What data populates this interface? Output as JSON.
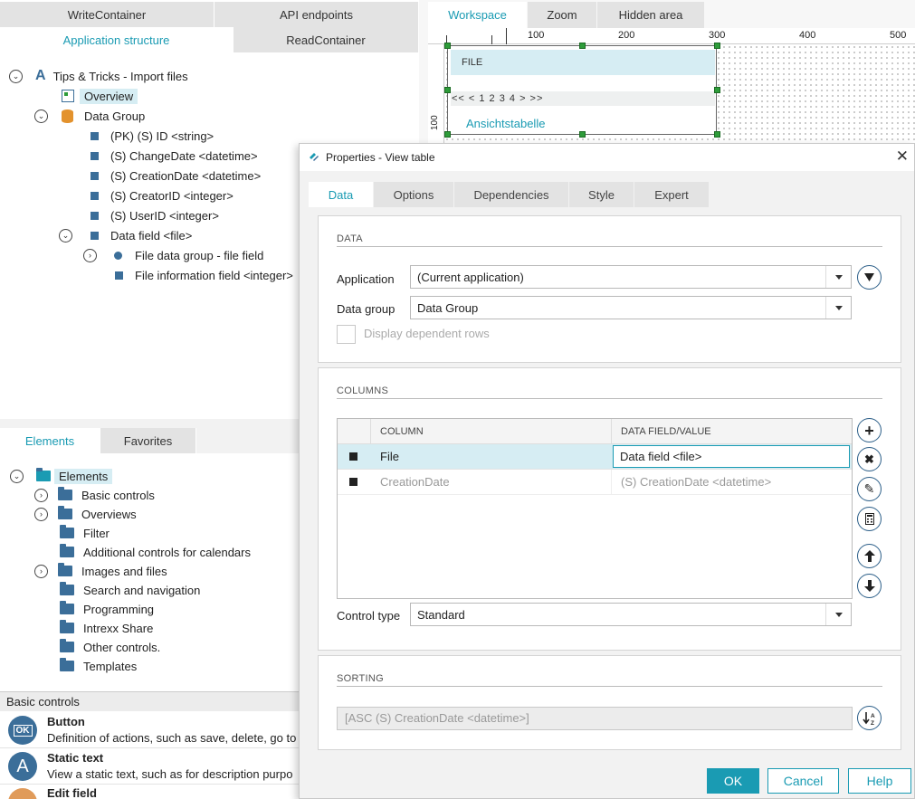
{
  "left_tabs": {
    "write_container": "WriteContainer",
    "api_endpoints": "API endpoints",
    "application_structure": "Application structure",
    "read_container": "ReadContainer"
  },
  "tree": {
    "root": "Tips & Tricks - Import files",
    "overview": "Overview",
    "data_group": "Data Group",
    "fields": [
      "(PK) (S) ID <string>",
      "(S) ChangeDate <datetime>",
      "(S) CreationDate <datetime>",
      "(S) CreatorID <integer>",
      "(S) UserID <integer>"
    ],
    "data_field": "Data field <file>",
    "file_data_group": "File data group - file field",
    "file_info_field": "File information field <integer>"
  },
  "elements_tabs": {
    "elements": "Elements",
    "favorites": "Favorites"
  },
  "elements_tree": {
    "root": "Elements",
    "items": [
      "Basic controls",
      "Overviews",
      "Filter",
      "Additional controls for calendars",
      "Images and files",
      "Search and navigation",
      "Programming",
      "Intrexx Share",
      "Other controls.",
      "Templates"
    ]
  },
  "basic_controls": {
    "header": "Basic controls",
    "items": [
      {
        "title": "Button",
        "desc": "Definition of actions, such as save, delete, go to",
        "icon_text": "OK"
      },
      {
        "title": "Static text",
        "desc": "View a static text, such as for description purpo",
        "icon_text": "A"
      },
      {
        "title": "Edit field",
        "desc": "",
        "icon_text": ""
      }
    ]
  },
  "workspace": {
    "tabs": {
      "workspace": "Workspace",
      "zoom": "Zoom",
      "hidden_area": "Hidden area"
    },
    "ruler": [
      "100",
      "200",
      "300",
      "400",
      "500"
    ],
    "ruler_v": "100",
    "file_label": "FILE",
    "pager": "<< < 1 2 3 4 > >>",
    "table_label": "Ansichtstabelle"
  },
  "dialog": {
    "title": "Properties - View table",
    "tabs": {
      "data": "Data",
      "options": "Options",
      "dependencies": "Dependencies",
      "style": "Style",
      "expert": "Expert"
    },
    "data_section": {
      "title": "DATA",
      "application_label": "Application",
      "application_value": "(Current application)",
      "data_group_label": "Data group",
      "data_group_value": "Data Group",
      "display_dependent": "Display dependent rows"
    },
    "columns_section": {
      "title": "COLUMNS",
      "col_header": "COLUMN",
      "field_header": "DATA FIELD/VALUE",
      "rows": [
        {
          "column": "File",
          "field": "Data field <file>"
        },
        {
          "column": "CreationDate",
          "field": "(S) CreationDate <datetime>"
        }
      ],
      "control_type_label": "Control type",
      "control_type_value": "Standard"
    },
    "sorting_section": {
      "title": "SORTING",
      "value": "[ASC (S) CreationDate <datetime>]"
    },
    "buttons": {
      "ok": "OK",
      "cancel": "Cancel",
      "help": "Help"
    },
    "colors": {
      "accent": "#1a9bb3",
      "icon_border": "#2b5e88",
      "selected_row": "#d6edf3"
    }
  }
}
